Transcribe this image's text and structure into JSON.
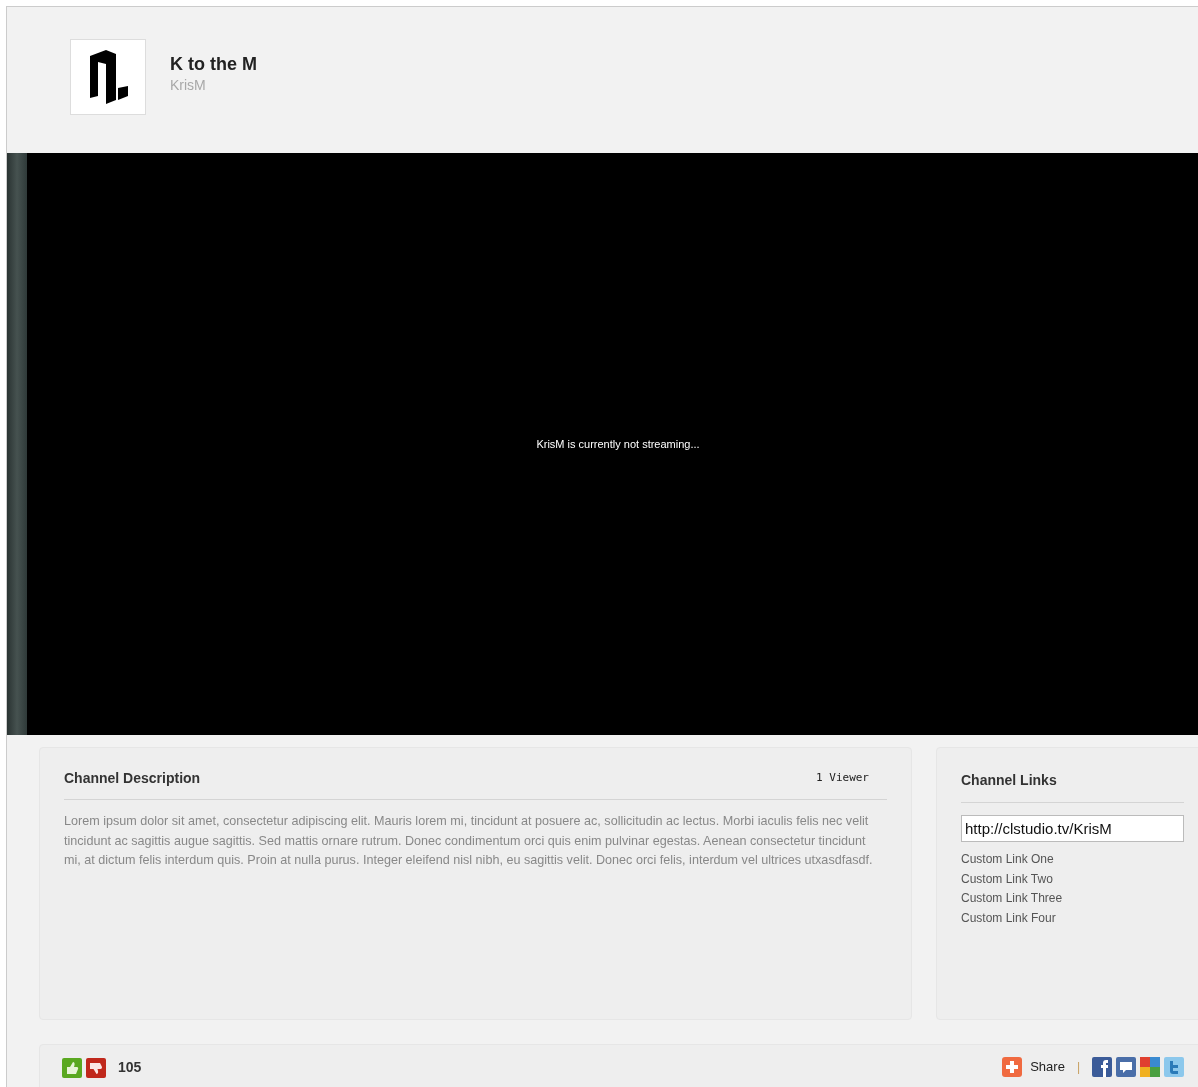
{
  "channel": {
    "title": "K to the M",
    "username": "KrisM"
  },
  "player": {
    "message": "KrisM is currently not streaming..."
  },
  "description": {
    "heading": "Channel Description",
    "viewers": "1 Viewer",
    "text": "Lorem ipsum dolor sit amet, consectetur adipiscing elit. Mauris lorem mi, tincidunt at posuere ac, sollicitudin ac lectus. Morbi iaculis felis nec velit tincidunt ac sagittis augue sagittis. Sed mattis ornare rutrum. Donec condimentum orci quis enim pulvinar egestas. Aenean consectetur tincidunt mi, at dictum felis interdum quis. Proin at nulla purus. Integer eleifend nisl nibh, eu sagittis velit. Donec orci felis, interdum vel ultrices utxasdfasdf."
  },
  "links": {
    "heading": "Channel Links",
    "url": "http://clstudio.tv/KrisM",
    "items": [
      "Custom Link One",
      "Custom Link Two",
      "Custom Link Three",
      "Custom Link Four"
    ]
  },
  "footer": {
    "score": "105",
    "share_label": "Share",
    "separator": "|"
  }
}
